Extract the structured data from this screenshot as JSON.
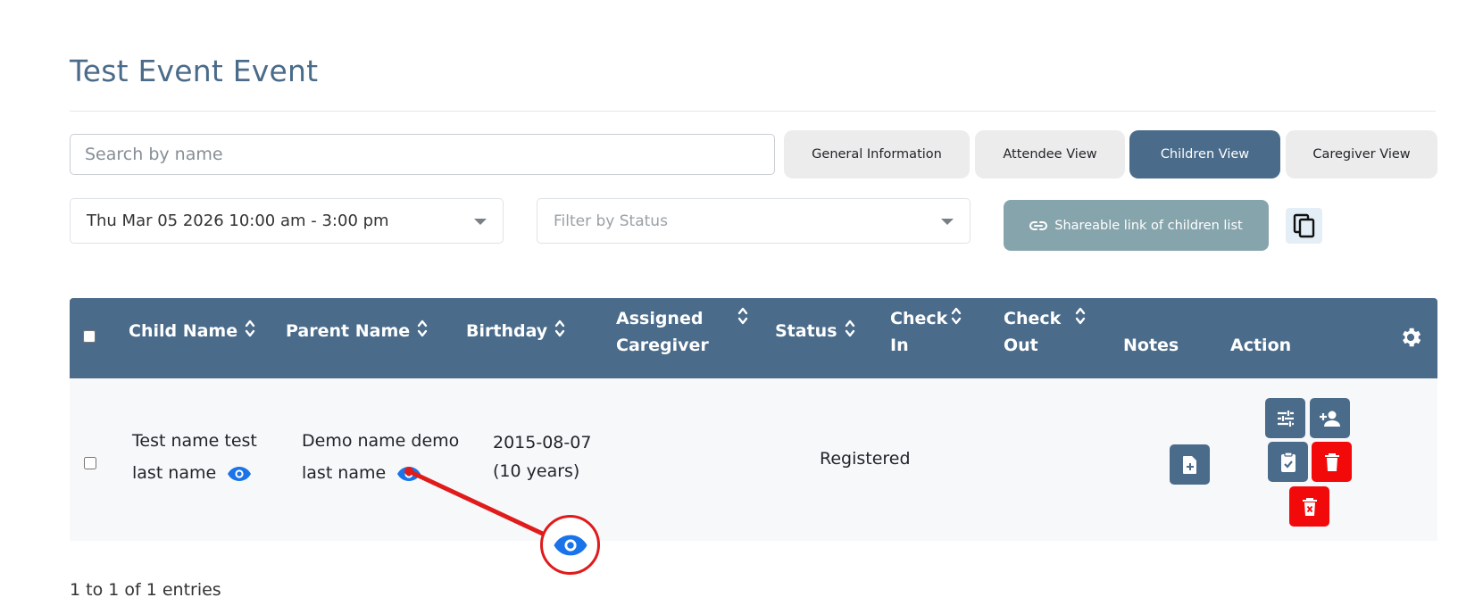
{
  "page": {
    "title": "Test Event Event"
  },
  "search": {
    "placeholder": "Search by name"
  },
  "tabs": [
    {
      "label": "General Information",
      "active": false
    },
    {
      "label": "Attendee View",
      "active": false
    },
    {
      "label": "Children View",
      "active": true
    },
    {
      "label": "Caregiver View",
      "active": false
    }
  ],
  "filters": {
    "date_selected": "Thu Mar 05 2026 10:00 am - 3:00 pm",
    "status_placeholder": "Filter by Status"
  },
  "share": {
    "label": "Shareable link of children list",
    "icon": "link-icon"
  },
  "copy": {
    "icon": "copy-icon"
  },
  "table": {
    "columns": [
      {
        "label": "Child Name",
        "sortable": true
      },
      {
        "label": "Parent Name",
        "sortable": true
      },
      {
        "label": "Birthday",
        "sortable": true
      },
      {
        "label": "Assigned Caregiver",
        "sortable": true
      },
      {
        "label": "Status",
        "sortable": true
      },
      {
        "label": "Check In",
        "sortable": true
      },
      {
        "label": "Check Out",
        "sortable": true
      },
      {
        "label": "Notes",
        "sortable": false
      },
      {
        "label": "Action",
        "sortable": false
      }
    ],
    "rows": [
      {
        "child_name": "Test name test last name",
        "parent_name": "Demo name demo last name",
        "birthday": "2015-08-07 (10 years)",
        "assigned_caregiver": "",
        "status": "Registered",
        "check_in": "",
        "check_out": ""
      }
    ]
  },
  "footer": {
    "entries": "1 to 1 of 1 entries"
  },
  "colors": {
    "primary": "#4a6b8a",
    "danger": "#f20a0a",
    "eye": "#1a73e8",
    "annotation": "#e01b1b",
    "share": "#86a4ac"
  }
}
